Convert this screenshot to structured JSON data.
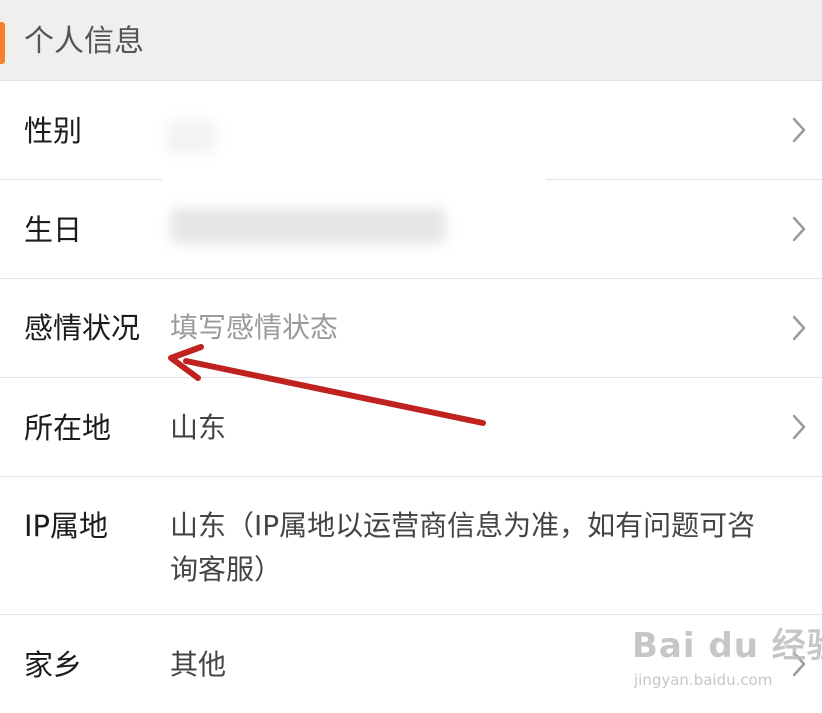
{
  "section": {
    "title": "个人信息"
  },
  "rows": [
    {
      "label": "性别",
      "value": "",
      "has_chevron": true
    },
    {
      "label": "生日",
      "value": "",
      "has_chevron": true
    },
    {
      "label": "感情状况",
      "placeholder": "填写感情状态",
      "has_chevron": true
    },
    {
      "label": "所在地",
      "value": "山东",
      "has_chevron": true
    },
    {
      "label": "IP属地",
      "value": "山东（IP属地以运营商信息为准，如有问题可咨询客服）",
      "has_chevron": false
    },
    {
      "label": "家乡",
      "value": "其他",
      "has_chevron": true
    }
  ],
  "watermark": {
    "logo": "Bai du 经验",
    "url": "jingyan.baidu.com"
  },
  "icons": {
    "row_chevron": "chevron-right-icon",
    "annotation": "red-arrow-annotation"
  },
  "colors": {
    "accent": "#f5822a",
    "header_bg": "#efefef",
    "label_text": "#1c1c1c",
    "value_text": "#444444",
    "placeholder_text": "#9a9a9a",
    "annotation_arrow": "#c0221f"
  }
}
